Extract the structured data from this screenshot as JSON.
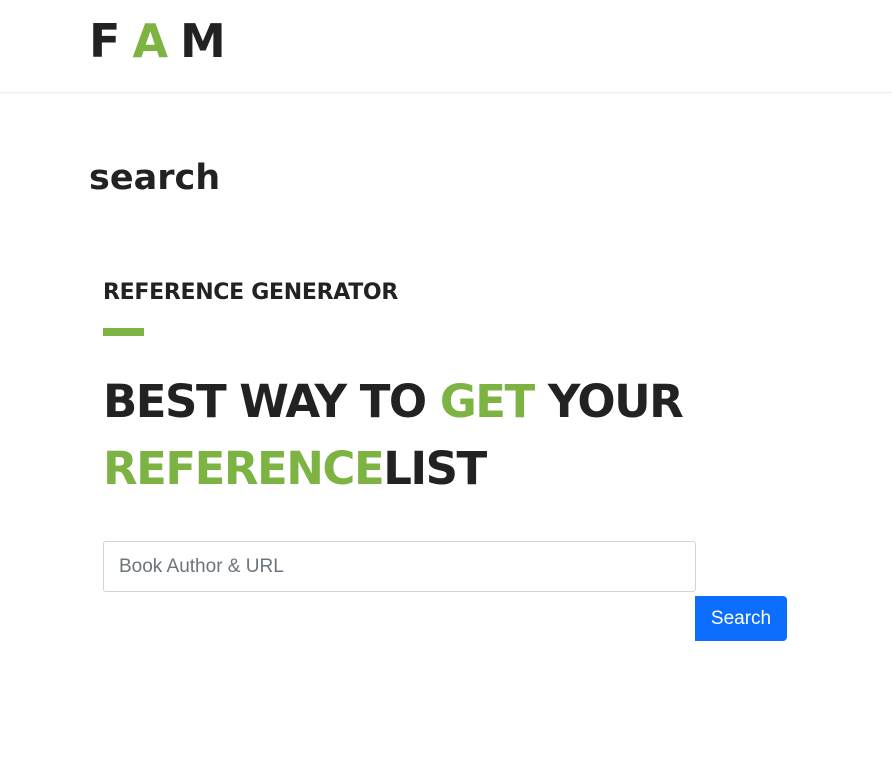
{
  "header": {
    "logo": {
      "letters": [
        "F",
        "A",
        "M"
      ],
      "accent_color": "#7cb342"
    }
  },
  "page": {
    "title": "search"
  },
  "hero": {
    "kicker": "REFERENCE GENERATOR",
    "headline": {
      "part1": "BEST WAY TO ",
      "part2": "GET",
      "part3": " YOUR ",
      "part4": "REFERENCE",
      "part5": "LIST"
    }
  },
  "search": {
    "placeholder": "Book Author & URL",
    "value": "",
    "button_label": "Search",
    "button_color": "#0d6efd"
  },
  "colors": {
    "text_dark": "#222222",
    "accent_green": "#7cb342"
  }
}
